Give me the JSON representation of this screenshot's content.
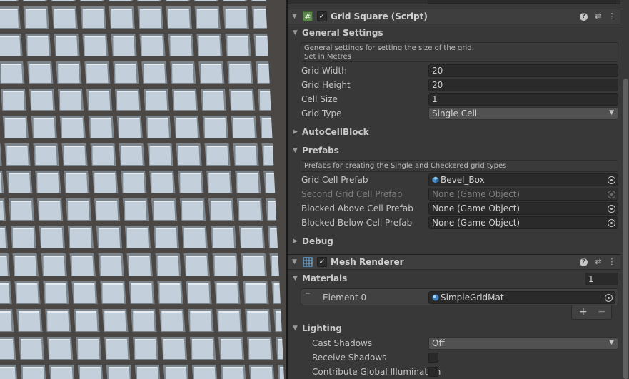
{
  "grid_square": {
    "title": "Grid Square (Script)",
    "icon": "script-hash-icon",
    "enabled": true,
    "general_settings": {
      "title": "General Settings",
      "help_line1": "General settings for setting the size of the grid.",
      "help_line2": "Set in Metres",
      "fields": {
        "grid_width": {
          "label": "Grid Width",
          "value": "20"
        },
        "grid_height": {
          "label": "Grid Height",
          "value": "20"
        },
        "cell_size": {
          "label": "Cell Size",
          "value": "1"
        },
        "grid_type": {
          "label": "Grid Type",
          "value": "Single Cell"
        }
      }
    },
    "auto_cell_block": {
      "title": "AutoCellBlock"
    },
    "prefabs": {
      "title": "Prefabs",
      "help": "Prefabs for creating the Single and Checkered grid types",
      "grid_cell": {
        "label": "Grid Cell Prefab",
        "value": "Bevel_Box"
      },
      "second_grid_cell": {
        "label": "Second Grid Cell Prefab",
        "value": "None (Game Object)"
      },
      "blocked_above": {
        "label": "Blocked Above Cell Prefab",
        "value": "None (Game Object)"
      },
      "blocked_below": {
        "label": "Blocked Below Cell Prefab",
        "value": "None (Game Object)"
      }
    },
    "debug": {
      "title": "Debug"
    }
  },
  "mesh_renderer": {
    "title": "Mesh Renderer",
    "icon": "mesh-renderer-icon",
    "enabled": true,
    "materials": {
      "title": "Materials",
      "count": "1",
      "element_label": "Element 0",
      "element_value": "SimpleGridMat",
      "add": "+",
      "remove": "−"
    },
    "lighting": {
      "title": "Lighting",
      "cast_shadows": {
        "label": "Cast Shadows",
        "value": "Off"
      },
      "receive_shadows": {
        "label": "Receive Shadows"
      },
      "contribute_gi": {
        "label": "Contribute Global Illumination"
      }
    }
  },
  "header_icons": {
    "help": "?",
    "presets": "⇄",
    "menu": "⋮"
  },
  "colors": {
    "inspector_bg": "#383838",
    "header_bg": "#3e3e3e",
    "field_bg": "#2a2a2a",
    "tile": "#c3d0db",
    "tile_bevel": "#7d858c",
    "gap": "#4a4744"
  }
}
